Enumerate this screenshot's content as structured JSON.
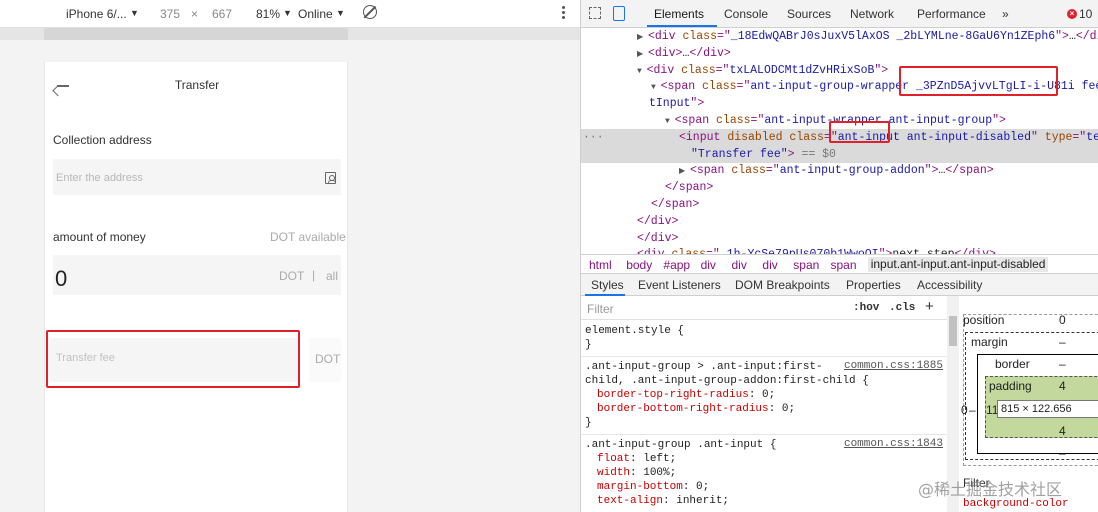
{
  "device_toolbar": {
    "device": "iPhone 6/...",
    "width": "375",
    "times": "×",
    "height": "667",
    "zoom": "81%",
    "network": "Online"
  },
  "app": {
    "title": "Transfer",
    "collection_label": "Collection address",
    "address_placeholder": "Enter the address",
    "amount_label": "amount of money",
    "available_label": "DOT available",
    "amount_value": "0",
    "unit": "DOT",
    "separator": "|",
    "all_label": "all",
    "fee_placeholder": "Transfer fee",
    "fee_unit": "DOT",
    "highlight_color": "#e0202a"
  },
  "devtools": {
    "tabs": [
      "Elements",
      "Console",
      "Sources",
      "Network",
      "Performance"
    ],
    "more": "»",
    "error_count": "10",
    "dom_lines": [
      {
        "indent": 0,
        "tri": "▶",
        "parts": [
          [
            "tag",
            "<div "
          ],
          [
            "an",
            "class"
          ],
          [
            "tag",
            "=\""
          ],
          [
            "av",
            "_18EdwQABrJ0sJuxV5lAxOS _2bLYMLne-8GaU6Yn1ZEph6"
          ],
          [
            "tag",
            "\">"
          ],
          [
            "tx",
            "…"
          ],
          [
            "tag",
            "</div>"
          ]
        ]
      },
      {
        "indent": 0,
        "tri": "▶",
        "parts": [
          [
            "tag",
            "<div>"
          ],
          [
            "tx",
            "…"
          ],
          [
            "tag",
            "</div>"
          ]
        ]
      },
      {
        "indent": 0,
        "tri": "▼",
        "parts": [
          [
            "tag",
            "<div "
          ],
          [
            "an",
            "class"
          ],
          [
            "tag",
            "=\""
          ],
          [
            "av",
            "txLALODCMt1dZvHRixSoB"
          ],
          [
            "tag",
            "\">"
          ]
        ]
      },
      {
        "indent": 1,
        "tri": "▼",
        "parts": [
          [
            "tag",
            "<span "
          ],
          [
            "an",
            "class"
          ],
          [
            "tag",
            "=\""
          ],
          [
            "av",
            "ant-input-group-wrapper _3PZnD5AjvvLTgLI-i-U81i feeInp"
          ]
        ]
      },
      {
        "indent": 0,
        "tri": "",
        "parts": [
          [
            "av",
            "tInput"
          ],
          [
            "tag",
            "\">"
          ]
        ]
      },
      {
        "indent": 2,
        "tri": "▼",
        "parts": [
          [
            "tag",
            "<span "
          ],
          [
            "an",
            "class"
          ],
          [
            "tag",
            "=\""
          ],
          [
            "av",
            "ant-input-wrapper ant-input-group"
          ],
          [
            "tag",
            "\">"
          ]
        ]
      },
      {
        "indent": 3,
        "tri": "",
        "parts": [
          [
            "tag",
            "<input "
          ],
          [
            "an",
            "disabled class"
          ],
          [
            "tag",
            "=\""
          ],
          [
            "av",
            "ant-input ant-input-disabled"
          ],
          [
            "tag",
            "\" "
          ],
          [
            "an",
            "type"
          ],
          [
            "tag",
            "=\""
          ],
          [
            "av",
            "text"
          ]
        ]
      },
      {
        "indent": 3,
        "tri": "",
        "parts": [
          [
            "av",
            "\"Transfer fee\""
          ],
          [
            "tag",
            "> "
          ],
          [
            "gray",
            "== $0"
          ]
        ]
      },
      {
        "indent": 3,
        "tri": "▶",
        "parts": [
          [
            "tag",
            "<span "
          ],
          [
            "an",
            "class"
          ],
          [
            "tag",
            "=\""
          ],
          [
            "av",
            "ant-input-group-addon"
          ],
          [
            "tag",
            "\">"
          ],
          [
            "tx",
            "…"
          ],
          [
            "tag",
            "</span>"
          ]
        ]
      },
      {
        "indent": 2,
        "tri": "",
        "parts": [
          [
            "tag",
            "</span>"
          ]
        ]
      },
      {
        "indent": 1,
        "tri": "",
        "parts": [
          [
            "tag",
            "</span>"
          ]
        ]
      },
      {
        "indent": 0,
        "tri": "",
        "parts": [
          [
            "tag",
            "</div>"
          ]
        ]
      },
      {
        "indent": -1,
        "tri": "",
        "parts": [
          [
            "tag",
            "</div>"
          ]
        ]
      },
      {
        "indent": -1,
        "tri": "",
        "parts": [
          [
            "tag",
            "<div "
          ],
          [
            "an",
            "class"
          ],
          [
            "tag",
            "=\""
          ],
          [
            "av",
            "_1h-YcSe79pUs070b1WwoOI"
          ],
          [
            "tag",
            "\">"
          ],
          [
            "tx",
            "next step"
          ],
          [
            "tag",
            "</div>"
          ]
        ]
      }
    ],
    "breadcrumbs": [
      "html",
      "body",
      "#app",
      "div",
      "div",
      "div",
      "span",
      "span",
      "input.ant-input.ant-input-disabled"
    ],
    "style_tabs": [
      "Styles",
      "Event Listeners",
      "DOM Breakpoints",
      "Properties",
      "Accessibility"
    ],
    "filter_placeholder": "Filter",
    "hov": ":hov",
    "cls": ".cls",
    "plus": "+",
    "rules": [
      {
        "selector": "element.style {",
        "link": "",
        "props": [],
        "close": "}"
      },
      {
        "selector": ".ant-input-group > .ant-input:first-",
        "selector2": "child, .ant-input-group-addon:first-child {",
        "link": "common.css:1885",
        "props": [
          [
            "border-top-right-radius",
            "0;"
          ],
          [
            "border-bottom-right-radius",
            "0;"
          ]
        ],
        "close": "}"
      },
      {
        "selector": ".ant-input-group .ant-input {",
        "link": "common.css:1843",
        "props": [
          [
            "float",
            "left;"
          ],
          [
            "width",
            "100%;"
          ],
          [
            "margin-bottom",
            "0;"
          ],
          [
            "text-align",
            "inherit;"
          ]
        ],
        "close": ""
      }
    ],
    "box_model": {
      "position_label": "position",
      "position_value": "0",
      "margin_label": "margin",
      "margin_value": "–",
      "border_label": "border",
      "border_value": "–",
      "padding_label": "padding",
      "padding_value": "4",
      "padding_bottom": "4",
      "left_value": "11",
      "dash_left": "–",
      "content_size": "815 × 122.656",
      "bottom_dash": "–",
      "side_zero": "0",
      "filter_label": "Filter",
      "bg_color_prop": "background-color"
    },
    "watermark": "@稀土掘金技术社区"
  }
}
